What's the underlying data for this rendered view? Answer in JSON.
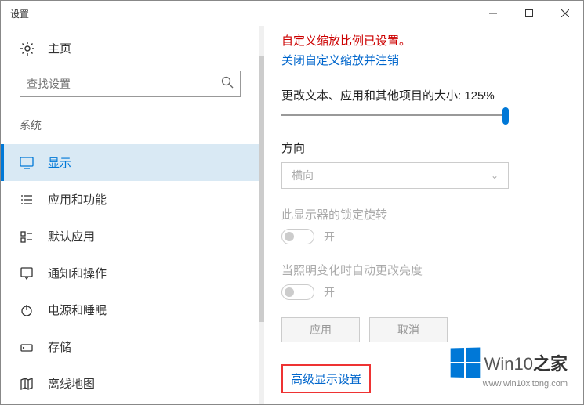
{
  "window": {
    "title": "设置"
  },
  "sidebar": {
    "home_label": "主页",
    "search_placeholder": "查找设置",
    "category": "系统",
    "items": [
      {
        "label": "显示"
      },
      {
        "label": "应用和功能"
      },
      {
        "label": "默认应用"
      },
      {
        "label": "通知和操作"
      },
      {
        "label": "电源和睡眠"
      },
      {
        "label": "存储"
      },
      {
        "label": "离线地图"
      }
    ]
  },
  "main": {
    "warning": "自定义缩放比例已设置。",
    "warning_link": "关闭自定义缩放并注销",
    "scale_label": "更改文本、应用和其他项目的大小: 125%",
    "orientation_label": "方向",
    "orientation_value": "横向",
    "lock_rotation_label": "此显示器的锁定旋转",
    "lock_rotation_state": "开",
    "brightness_label": "当照明变化时自动更改亮度",
    "brightness_state": "开",
    "apply_btn": "应用",
    "cancel_btn": "取消",
    "advanced_link": "高级显示设置"
  },
  "watermark": {
    "brand_prefix": "Win10",
    "brand_suffix": "之家",
    "url": "www.win10xitong.com"
  }
}
